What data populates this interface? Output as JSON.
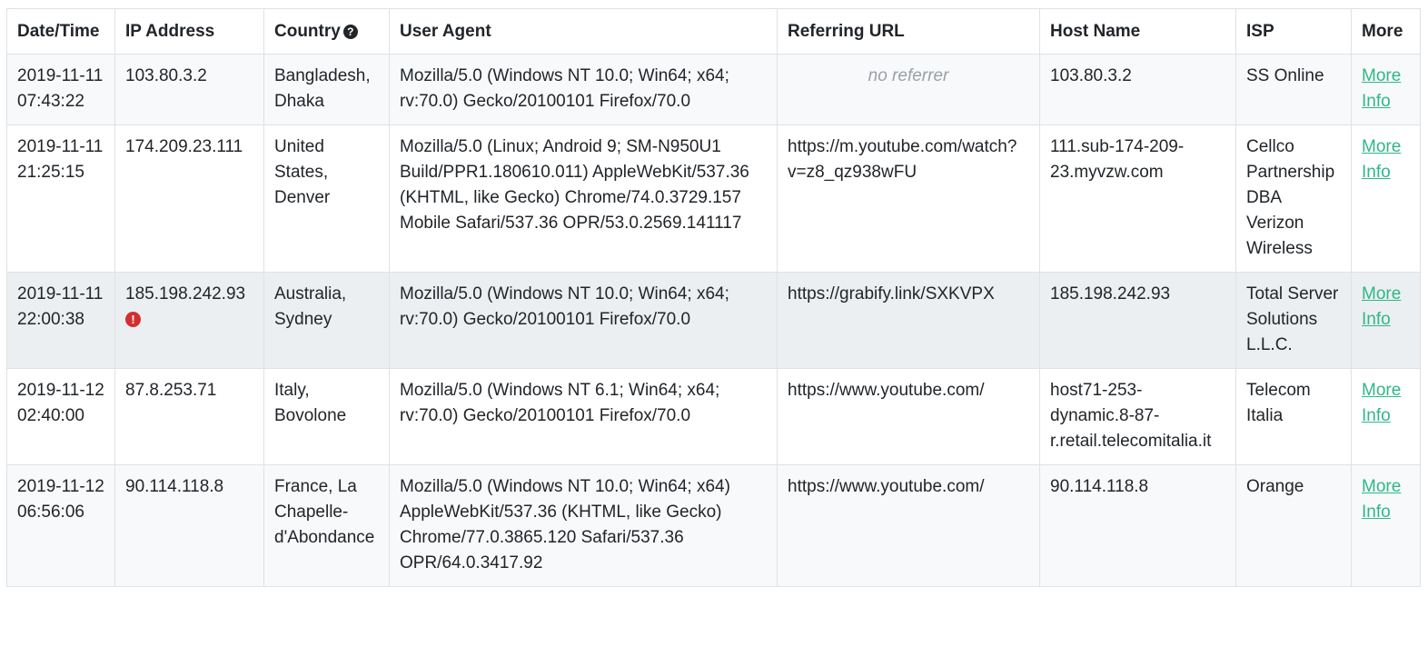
{
  "columns": {
    "datetime": "Date/Time",
    "ip": "IP Address",
    "country": "Country",
    "useragent": "User Agent",
    "referrer": "Referring URL",
    "host": "Host Name",
    "isp": "ISP",
    "more": "More"
  },
  "icons": {
    "country_help": "question-circle-icon",
    "ip_warning": "exclamation-circle-icon"
  },
  "colors": {
    "link": "#2eb886",
    "warning": "#d32f2f",
    "highlight_row": "#eceff1",
    "muted_text": "#9aa0a6"
  },
  "rows": [
    {
      "datetime": "2019-11-11 07:43:22",
      "ip": "103.80.3.2",
      "country": "Bangladesh, Dhaka",
      "useragent": "Mozilla/5.0 (Windows NT 10.0; Win64; x64; rv:70.0) Gecko/20100101 Firefox/70.0",
      "referrer": "no referrer",
      "host": "103.80.3.2",
      "isp": "SS Online",
      "more": "More Info"
    },
    {
      "datetime": "2019-11-11 21:25:15",
      "ip": "174.209.23.111",
      "country": "United States, Denver",
      "useragent": "Mozilla/5.0 (Linux; Android 9; SM-N950U1 Build/PPR1.180610.011) AppleWebKit/537.36 (KHTML, like Gecko) Chrome/74.0.3729.157 Mobile Safari/537.36 OPR/53.0.2569.141117",
      "referrer": "https://m.youtube.com/watch?v=z8_qz938wFU",
      "host": "111.sub-174-209-23.myvzw.com",
      "isp": "Cellco Partnership DBA Verizon Wireless",
      "more": "More Info"
    },
    {
      "datetime": "2019-11-11 22:00:38",
      "ip": "185.198.242.93",
      "country": "Australia, Sydney",
      "useragent": "Mozilla/5.0 (Windows NT 10.0; Win64; x64; rv:70.0) Gecko/20100101 Firefox/70.0",
      "referrer": "https://grabify.link/SXKVPX",
      "host": "185.198.242.93",
      "isp": "Total Server Solutions L.L.C.",
      "more": "More Info"
    },
    {
      "datetime": "2019-11-12 02:40:00",
      "ip": "87.8.253.71",
      "country": "Italy, Bovolone",
      "useragent": "Mozilla/5.0 (Windows NT 6.1; Win64; x64; rv:70.0) Gecko/20100101 Firefox/70.0",
      "referrer": "https://www.youtube.com/",
      "host": "host71-253-dynamic.8-87-r.retail.telecomitalia.it",
      "isp": "Telecom Italia",
      "more": "More Info"
    },
    {
      "datetime": "2019-11-12 06:56:06",
      "ip": "90.114.118.8",
      "country": "France, La Chapelle-d'Abondance",
      "useragent": "Mozilla/5.0 (Windows NT 10.0; Win64; x64) AppleWebKit/537.36 (KHTML, like Gecko) Chrome/77.0.3865.120 Safari/537.36 OPR/64.0.3417.92",
      "referrer": "https://www.youtube.com/",
      "host": "90.114.118.8",
      "isp": "Orange",
      "more": "More Info"
    }
  ]
}
